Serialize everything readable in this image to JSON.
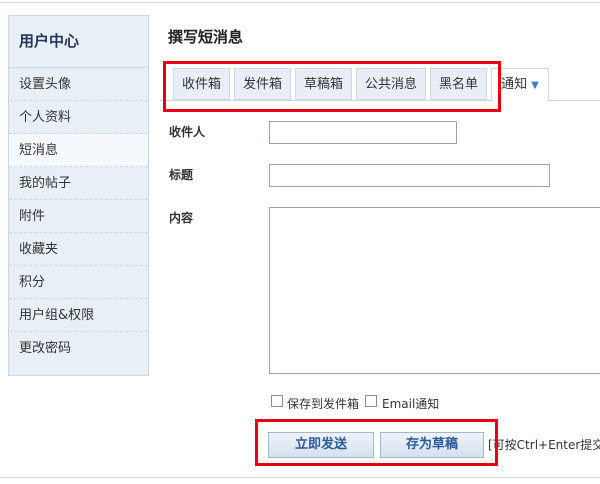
{
  "sidebar": {
    "title": "用户中心",
    "items": [
      {
        "label": "设置头像"
      },
      {
        "label": "个人资料"
      },
      {
        "label": "短消息"
      },
      {
        "label": "我的帖子"
      },
      {
        "label": "附件"
      },
      {
        "label": "收藏夹"
      },
      {
        "label": "积分"
      },
      {
        "label": "用户组&权限"
      },
      {
        "label": "更改密码"
      }
    ],
    "active_item": "短消息"
  },
  "main": {
    "title": "撰写短消息",
    "tabs": [
      {
        "label": "收件箱"
      },
      {
        "label": "发件箱"
      },
      {
        "label": "草稿箱"
      },
      {
        "label": "公共消息"
      },
      {
        "label": "黑名单"
      },
      {
        "label": "通知"
      }
    ],
    "form": {
      "recipient_label": "收件人",
      "recipient_value": "",
      "subject_label": "标题",
      "subject_value": "",
      "content_label": "内容",
      "content_value": ""
    },
    "options": {
      "save_to_outbox": {
        "label": "保存到发件箱",
        "checked": false
      },
      "email_notify": {
        "label": "Email通知",
        "checked": false
      }
    },
    "buttons": {
      "send": "立即发送",
      "save_draft": "存为草稿"
    },
    "hint": "[可按Ctrl+Enter提交]"
  },
  "colors": {
    "highlight": "#e60012",
    "sidebar_bg": "#e8eff7",
    "tab_bg": "#e8eef6",
    "button_text": "#2a5a9a"
  }
}
